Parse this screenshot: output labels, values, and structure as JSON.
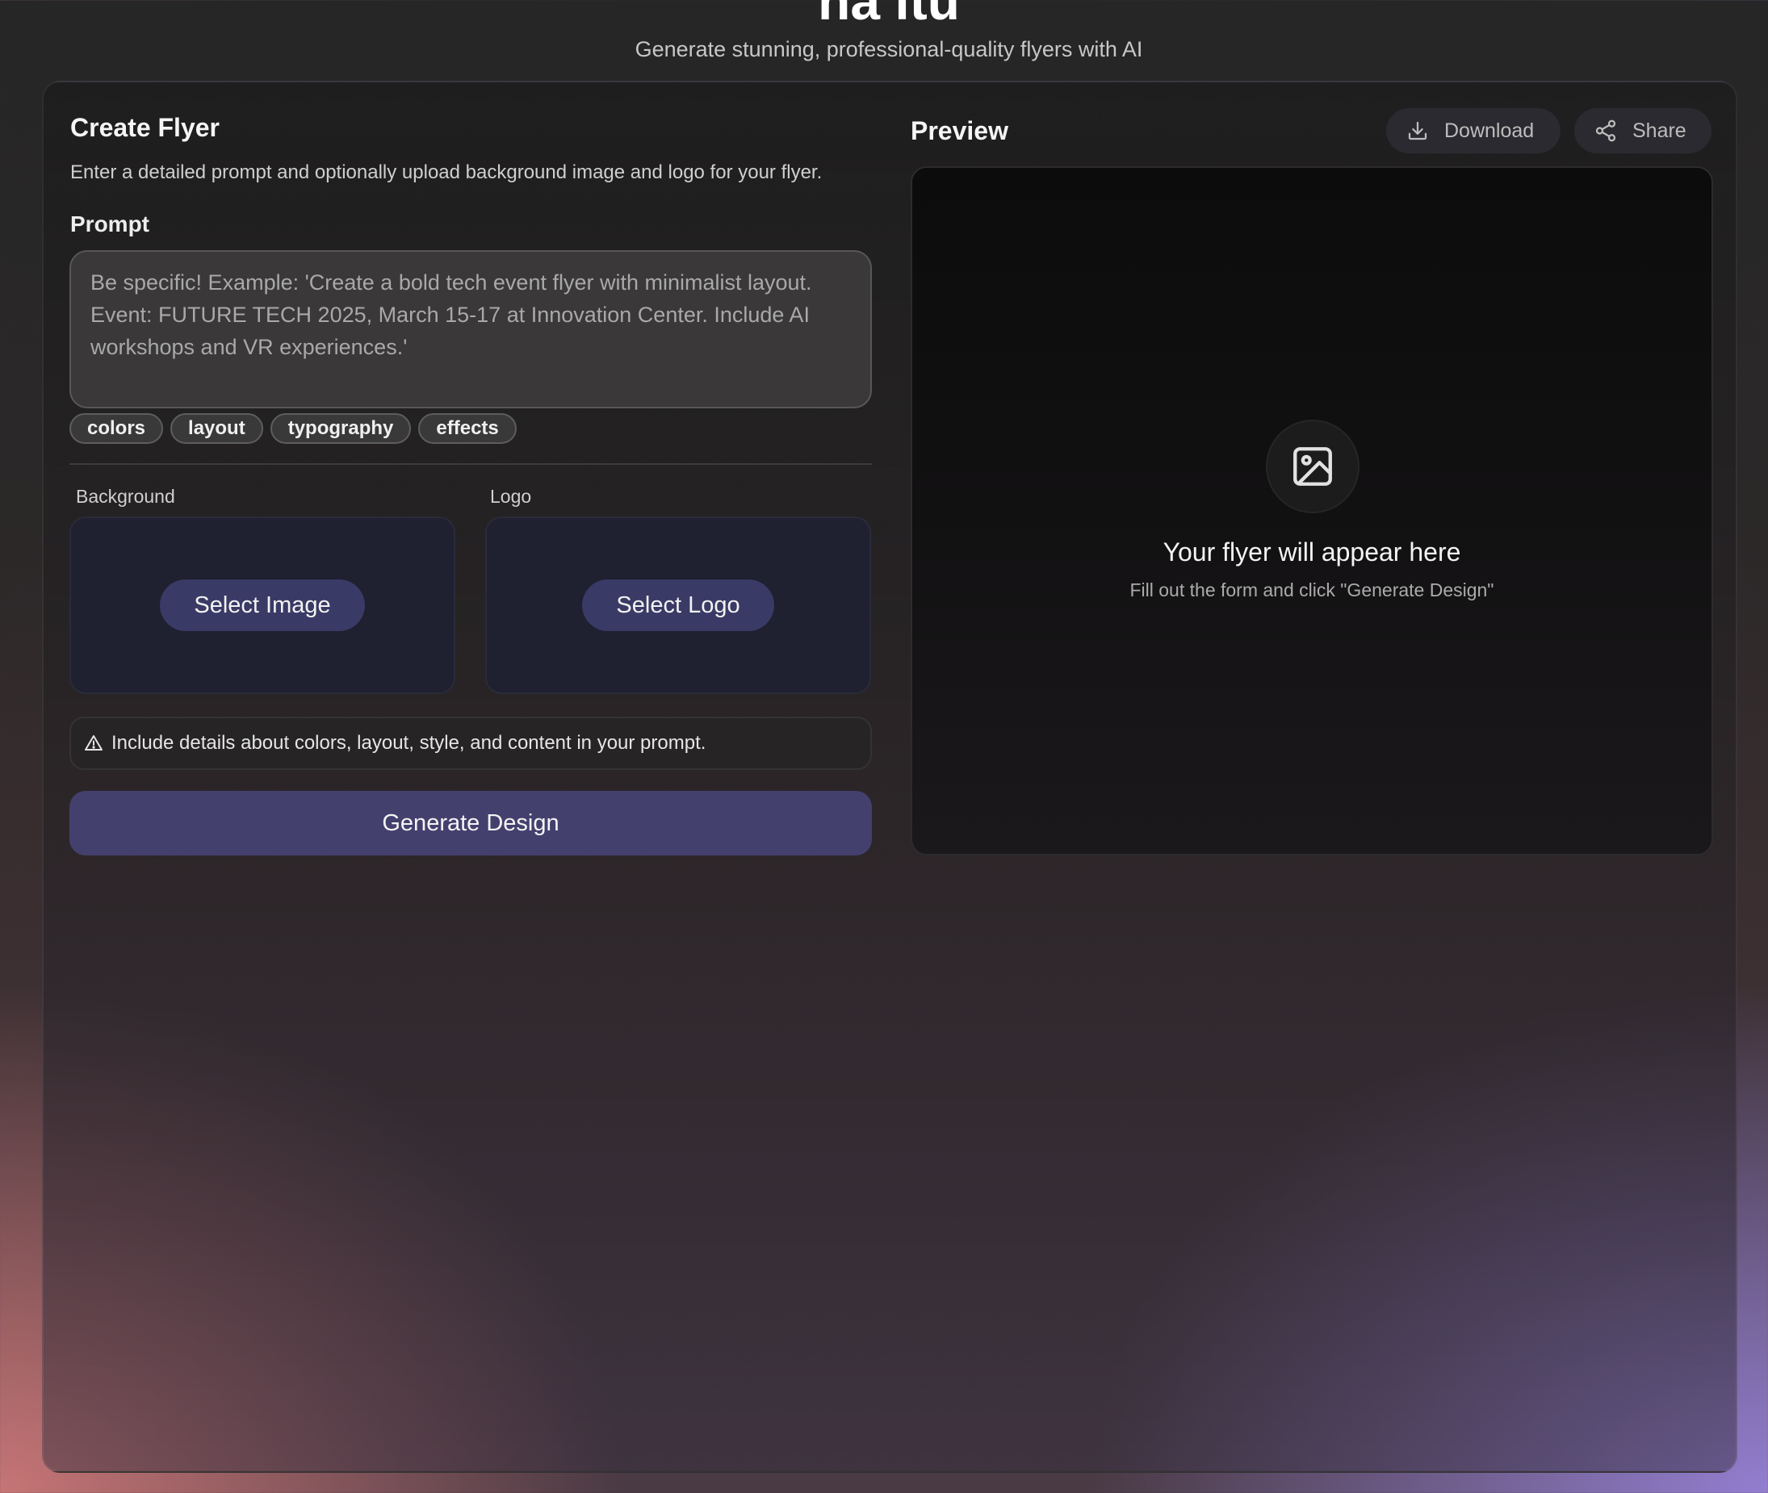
{
  "brand": {
    "title": "na ltu",
    "subtitle": "Generate stunning, professional-quality flyers with AI"
  },
  "form": {
    "title": "Create Flyer",
    "description": "Enter a detailed prompt and optionally upload background image and logo for your flyer.",
    "prompt_label": "Prompt",
    "prompt_value": "",
    "prompt_placeholder": "Be specific! Example: 'Create a bold tech event flyer with minimalist layout. Event: FUTURE TECH 2025, March 15-17 at Innovation Center. Include AI workshops and VR experiences.'",
    "chips": [
      "colors",
      "layout",
      "typography",
      "effects"
    ],
    "background": {
      "label": "Background",
      "button": "Select Image"
    },
    "logo": {
      "label": "Logo",
      "button": "Select Logo"
    },
    "hint": "Include details about colors, layout, style, and content in your prompt.",
    "generate_button": "Generate Design"
  },
  "preview": {
    "title": "Preview",
    "download_label": "Download",
    "share_label": "Share",
    "empty_title": "Your flyer will appear here",
    "empty_subtitle": "Fill out the form and click \"Generate Design\""
  },
  "icons": {
    "download": "download-icon",
    "share": "share-icon",
    "warning": "warning-icon",
    "image_placeholder": "image-icon"
  },
  "colors": {
    "accent_button": "#44406e",
    "pill_button": "#3a3a66",
    "upload_box": "#1f2030"
  }
}
